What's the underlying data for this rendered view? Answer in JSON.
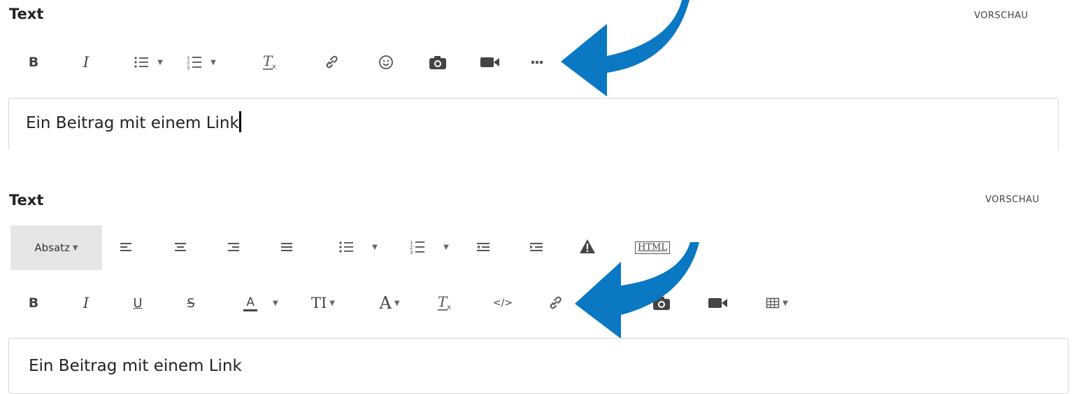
{
  "editor1": {
    "label": "Text",
    "preview": "VORSCHAU",
    "content": "Ein Beitrag mit einem Link"
  },
  "editor2": {
    "label": "Text",
    "preview": "VORSCHAU",
    "paragraph_select": "Absatz",
    "html_button": "HTML",
    "content": "Ein Beitrag mit einem Link"
  },
  "toolbar_glyphs": {
    "bold": "B",
    "italic": "I",
    "underline": "U",
    "strike": "S",
    "font_color": "A",
    "font_size": "TI",
    "font_family": "A",
    "code": "</>"
  },
  "annotation_color": "#0a78c2"
}
